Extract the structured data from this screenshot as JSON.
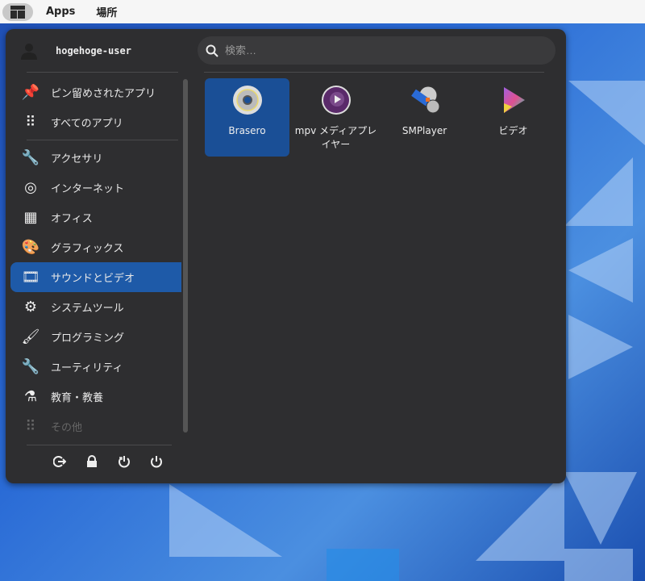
{
  "topbar": {
    "apps_label": "Apps",
    "places_label": "場所"
  },
  "user": {
    "name": "hogehoge-user"
  },
  "search": {
    "placeholder": "検索…"
  },
  "categories": [
    {
      "label": "ピン留めされたアプリ",
      "icon": "pin-icon"
    },
    {
      "label": "すべてのアプリ",
      "icon": "grid-icon"
    },
    {
      "label": "アクセサリ",
      "icon": "accessories-icon"
    },
    {
      "label": "インターネット",
      "icon": "globe-icon"
    },
    {
      "label": "オフィス",
      "icon": "office-icon"
    },
    {
      "label": "グラフィックス",
      "icon": "palette-icon"
    },
    {
      "label": "サウンドとビデオ",
      "icon": "film-music-icon"
    },
    {
      "label": "システムツール",
      "icon": "gear-icon"
    },
    {
      "label": "プログラミング",
      "icon": "brush-icon"
    },
    {
      "label": "ユーティリティ",
      "icon": "utilities-icon"
    },
    {
      "label": "教育・教養",
      "icon": "flask-icon"
    },
    {
      "label": "その他",
      "icon": "grid-icon"
    }
  ],
  "apps": [
    {
      "label": "Brasero"
    },
    {
      "label": "mpv メディアプレイヤー"
    },
    {
      "label": "SMPlayer"
    },
    {
      "label": "ビデオ"
    }
  ]
}
